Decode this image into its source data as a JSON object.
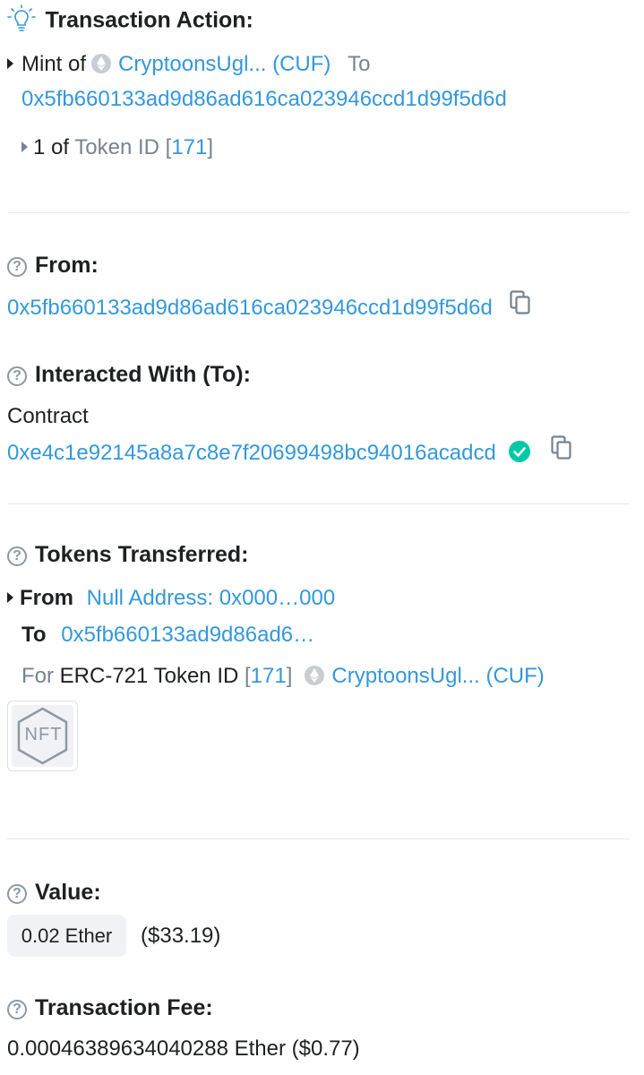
{
  "transaction_action": {
    "heading": "Transaction Action:",
    "mint_of": "Mint of",
    "token_name": "CryptoonsUgl... (CUF)",
    "to": "To",
    "to_address": "0x5fb660133ad9d86ad616ca023946ccd1d99f5d6d",
    "count": "1 of",
    "token_id_label": "Token ID",
    "token_id_open": "[",
    "token_id": "171",
    "token_id_close": "]"
  },
  "from": {
    "heading": "From:",
    "address": "0x5fb660133ad9d86ad616ca023946ccd1d99f5d6d"
  },
  "interacted_with": {
    "heading": "Interacted With (To):",
    "type": "Contract",
    "address": "0xe4c1e92145a8a7c8e7f20699498bc94016acadcd"
  },
  "tokens_transferred": {
    "heading": "Tokens Transferred:",
    "from_label": "From",
    "from_value": "Null Address: 0x000…000",
    "to_label": "To",
    "to_value": "0x5fb660133ad9d86ad6…",
    "for_label": "For",
    "erc_label": "ERC-721 Token ID",
    "id_open": "[",
    "token_id": "171",
    "id_close": "]",
    "token_name": "CryptoonsUgl... (CUF)",
    "nft_label": "NFT"
  },
  "value": {
    "heading": "Value:",
    "amount": "0.02 Ether",
    "usd": "($33.19)"
  },
  "transaction_fee": {
    "heading": "Transaction Fee:",
    "amount": "0.00046389634040288 Ether ($0.77)"
  },
  "colors": {
    "link": "#3498db",
    "muted": "#77838f",
    "text": "#1e2022",
    "success": "#00c9a7",
    "divider": "#e7eaf3"
  },
  "icons": [
    "lightbulb-icon",
    "question-circle-icon",
    "caret-right-icon",
    "ethereum-icon",
    "copy-icon",
    "check-circle-icon",
    "nft-icon"
  ]
}
